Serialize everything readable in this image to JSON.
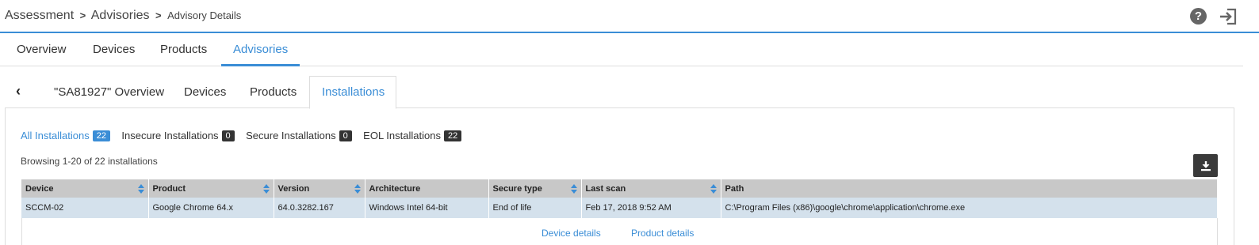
{
  "breadcrumb": {
    "item1": "Assessment",
    "item2": "Advisories",
    "item3": "Advisory Details",
    "separator": ">"
  },
  "header": {
    "help_icon": "help-icon",
    "help_glyph": "?",
    "exit_icon": "exit-icon"
  },
  "main_tabs": [
    {
      "label": "Overview"
    },
    {
      "label": "Devices"
    },
    {
      "label": "Products"
    },
    {
      "label": "Advisories",
      "active": true
    }
  ],
  "sub_tabs": {
    "back_icon": "chevron-left-icon",
    "back_glyph": "‹",
    "items": [
      {
        "label": "\"SA81927\" Overview"
      },
      {
        "label": "Devices"
      },
      {
        "label": "Products"
      },
      {
        "label": "Installations",
        "active": true
      }
    ]
  },
  "filters": [
    {
      "label": "All Installations",
      "count": "22",
      "active": true
    },
    {
      "label": "Insecure Installations",
      "count": "0"
    },
    {
      "label": "Secure Installations",
      "count": "0"
    },
    {
      "label": "EOL Installations",
      "count": "22"
    }
  ],
  "browsing": "Browsing 1-20 of 22 installations",
  "download_icon": "download-icon",
  "table": {
    "columns": [
      "Device",
      "Product",
      "Version",
      "Architecture",
      "Secure type",
      "Last scan",
      "Path"
    ],
    "rows": [
      [
        "SCCM-02",
        "Google Chrome 64.x",
        "64.0.3282.167",
        "Windows Intel 64-bit",
        "End of life",
        "Feb 17, 2018 9:52 AM",
        "C:\\Program Files (x86)\\google\\chrome\\application\\chrome.exe"
      ]
    ]
  },
  "details": {
    "device_link": "Device details",
    "product_link": "Product details"
  },
  "colors": {
    "accent": "#3a8dd6",
    "header_bg": "#c8c8c8",
    "row_selected": "#d4e1ec",
    "badge_dark": "#333333"
  }
}
